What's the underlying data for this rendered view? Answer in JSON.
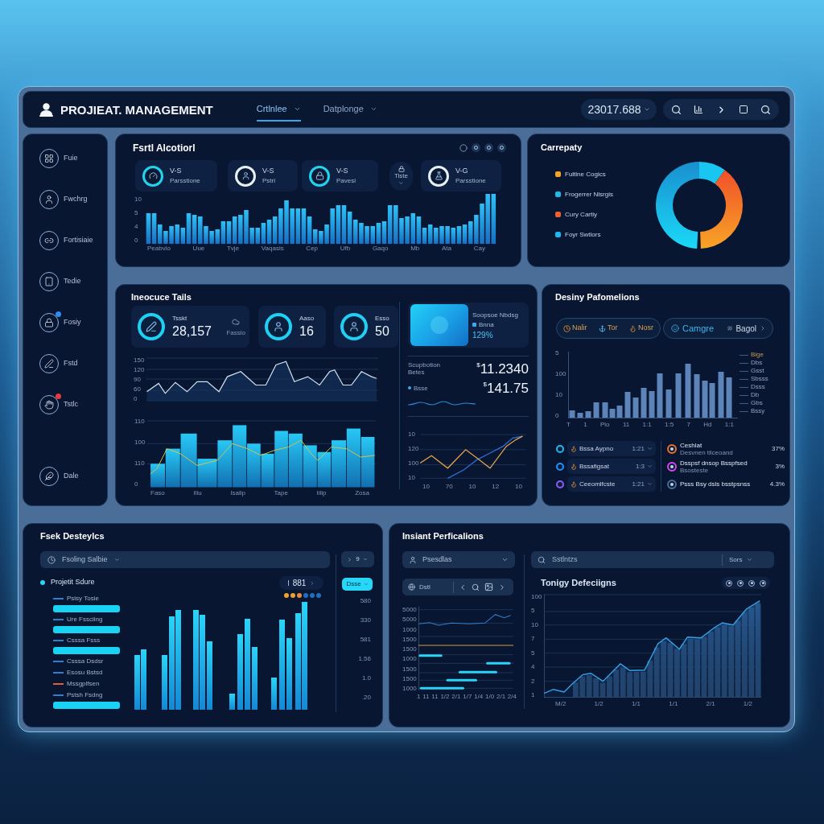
{
  "header": {
    "logo": "PROJIEAT. MANAGEMENT",
    "tabs": [
      {
        "label": "Crtlnlee",
        "selected": true
      },
      {
        "label": "Datplonge",
        "selected": false
      }
    ],
    "value_menu": "23017.688"
  },
  "sidebar": {
    "items": [
      {
        "label": "Fuie"
      },
      {
        "label": "Fwchrg"
      },
      {
        "label": "Fortisiaie"
      },
      {
        "label": "Tedie"
      },
      {
        "label": "Fosiy",
        "color": "#2f8cf0"
      },
      {
        "label": "Fstd"
      },
      {
        "label": "Tstlc",
        "color": "#e5393b"
      },
      {
        "label": "Dale"
      }
    ]
  },
  "activity_panel": {
    "title": "Fsrtl Alcotiorl",
    "stats": [
      {
        "kind": "card",
        "label": "V-S",
        "caption": "Parsstione",
        "color": "#22d3ee"
      },
      {
        "kind": "card",
        "label": "V-S",
        "caption": "Pstrl",
        "color": "#e8eef5"
      },
      {
        "kind": "card",
        "label": "V-S",
        "caption": "Pavesi",
        "color": "#22d3ee"
      },
      {
        "kind": "mini",
        "label": "Tiste"
      },
      {
        "kind": "card",
        "label": "V-G",
        "caption": "Parsstione",
        "color": "#e8eef5"
      }
    ],
    "y_ticks": [
      "10",
      "5",
      "4",
      "0"
    ],
    "x_labels": [
      "Peabvio",
      "Uue",
      "Tvje",
      "Vaqasis",
      "Cep",
      "Ufb",
      "Gaqo",
      "Mb",
      "Ata",
      "Cay"
    ]
  },
  "category_panel": {
    "title": "Carrepaty",
    "legend": [
      {
        "label": "Fultlne Cogics",
        "color": "#f5a524"
      },
      {
        "label": "Frogerrer Nlsrgis",
        "color": "#22b8e8"
      },
      {
        "label": "Cury Cartiy",
        "color": "#f0602a"
      },
      {
        "label": "Foyr Swtlors",
        "color": "#1fb5f0"
      }
    ]
  },
  "tasks_panel": {
    "title": "Ineocuce Tails",
    "stats": [
      {
        "label": "Tsskt",
        "value": "28,157",
        "note": "Fassio"
      },
      {
        "label": "Aaso",
        "value": "16"
      },
      {
        "label": "Esso",
        "value": "50"
      }
    ],
    "highlight": {
      "caption": "Soopsoe Nbdsg",
      "label": "Bnna",
      "value": "129%"
    },
    "readings": [
      {
        "label": "Scupbotion Betes",
        "prefix": "$",
        "value": "11.2340"
      },
      {
        "label": "Bsse",
        "prefix": "$",
        "value": "141.75"
      }
    ],
    "line_chart": {
      "y_ticks": [
        "150",
        "120",
        "90",
        "60",
        "0"
      ]
    },
    "area_chart": {
      "y_ticks": [
        "110",
        "100",
        "110",
        "0"
      ],
      "x_labels": [
        "Faso",
        "Iliu",
        "Isalip",
        "Tape",
        "Iilip",
        "Zosa"
      ]
    },
    "trend_chart": {
      "y_ticks": [
        "10",
        "120",
        "100",
        "10"
      ],
      "x_labels": [
        "10",
        "70",
        "10",
        "12",
        "10"
      ]
    }
  },
  "performance_panel": {
    "title": "Desiny Pafomelions",
    "filters": [
      {
        "label": "Nalir"
      },
      {
        "label": "Tor"
      },
      {
        "label": "Nosr"
      }
    ],
    "compare": {
      "label": "Camgre",
      "option": "Bagol"
    },
    "y_ticks": [
      "5",
      "100",
      "10",
      "0"
    ],
    "x_labels": [
      "T",
      "1",
      "Pio",
      "11",
      "1:1",
      "1:5",
      "7",
      "Hd",
      "1:1"
    ],
    "legend": [
      "Bige",
      "Dbs",
      "Gsst",
      "Sbsss",
      "Dsss",
      "Db",
      "Gbs",
      "Bssy"
    ],
    "items": [
      {
        "label": "Bssa Aypno",
        "value": "1:21",
        "color": "#22b8f0"
      },
      {
        "label": "Bssafigsat",
        "value": "1:3",
        "color": "#1e90ff"
      },
      {
        "label": "Ceeomlfcste",
        "value": "1:21",
        "color": "#8b5cf6"
      }
    ],
    "metrics": [
      {
        "title": "Ceshlat",
        "subtitle": "Desvnen tilceoand",
        "value": "37%",
        "color": "#f0702a"
      },
      {
        "title": "Dsspsf dnsop Bsspfsed",
        "subtitle": "Bsosteste",
        "value": "3%",
        "color": "#d946ef"
      },
      {
        "title": "Psss Bsy dsls bsstpsnss",
        "value": "4.3%",
        "color": "#4a6d96"
      }
    ]
  },
  "analytics_panel": {
    "title": "Fsek Desteylcs",
    "dropdown": "Fsoling Salbie",
    "page_menu": "9",
    "series_label": "Projetit Sdure",
    "series_menu": "881",
    "button": "Dsse",
    "list": [
      {
        "label": "Psisy Tosie",
        "color": "#2f7fd0",
        "highlighted": true
      },
      {
        "label": "Ure Fssciing",
        "color": "#2f7fd0",
        "highlighted": true
      },
      {
        "label": "Csssa Fsss",
        "color": "#2f7fd0",
        "highlighted": true
      },
      {
        "label": "Csssa Dsdsr",
        "color": "#2f7fd0",
        "highlighted": false
      },
      {
        "label": "Esosu Bstsd",
        "color": "#2f7fd0",
        "highlighted": false
      },
      {
        "label": "Mssgplfsen",
        "color": "#e0603a",
        "highlighted": false
      },
      {
        "label": "Pstsh Fsdng",
        "color": "#2f7fd0",
        "highlighted": true
      }
    ],
    "y_ticks": [
      "580",
      "330",
      "581",
      "1.56",
      "1.0",
      ".20"
    ]
  },
  "timeline_panel": {
    "title": "Insiant Perficalions",
    "dropdown": "Psesdlas",
    "toolbar_label": "Dstl",
    "y_ticks": [
      "5000",
      "5000",
      "1000",
      "1500",
      "1500",
      "1000",
      "1500",
      "1500",
      "1000"
    ],
    "x_labels": [
      "1",
      "11",
      "11",
      "1/2",
      "2/1",
      "1/7",
      "1/4",
      "1/0",
      "2/1",
      "2/4"
    ],
    "search": {
      "placeholder": "Sstlntzs"
    },
    "sort": "Sors",
    "chart_title": "Tonigy Defeciigns",
    "chart_y_ticks": [
      "100",
      "5",
      "10",
      "7",
      "5",
      "4",
      "2",
      "1"
    ],
    "chart_x_labels": [
      "M/2",
      "1/2",
      "1/1",
      "1/1",
      "2/1",
      "1/2"
    ]
  }
}
